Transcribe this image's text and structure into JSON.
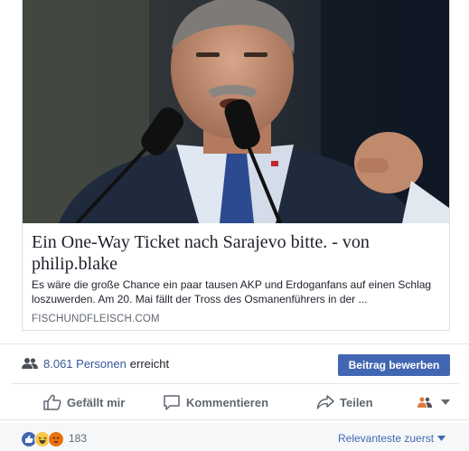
{
  "link": {
    "title": "Ein One-Way Ticket nach Sarajevo bitte. - von philip.blake",
    "description": "Es wäre die große Chance ein paar tausen AKP und Erdoganfans auf einen Schlag loszuwerden. Am 20. Mai fällt der Tross des Osmanenführers in der ...",
    "domain": "FISCHUNDFLEISCH.COM"
  },
  "reach": {
    "count": "8.061 Personen",
    "suffix": "erreicht"
  },
  "boost_button": "Beitrag bewerben",
  "actions": {
    "like": "Gefällt mir",
    "comment": "Kommentieren",
    "share": "Teilen"
  },
  "reactions": {
    "count": "183",
    "sort_label": "Relevanteste zuerst"
  },
  "icons": [
    "people-icon",
    "like-icon",
    "comment-icon",
    "share-icon",
    "audience-icon",
    "chevron-down-icon",
    "like-reaction-icon",
    "haha-reaction-icon",
    "angry-reaction-icon"
  ],
  "colors": {
    "link_blue": "#365899",
    "button_blue": "#4267b2",
    "text_dark": "#1d2129",
    "text_gray": "#606770"
  }
}
